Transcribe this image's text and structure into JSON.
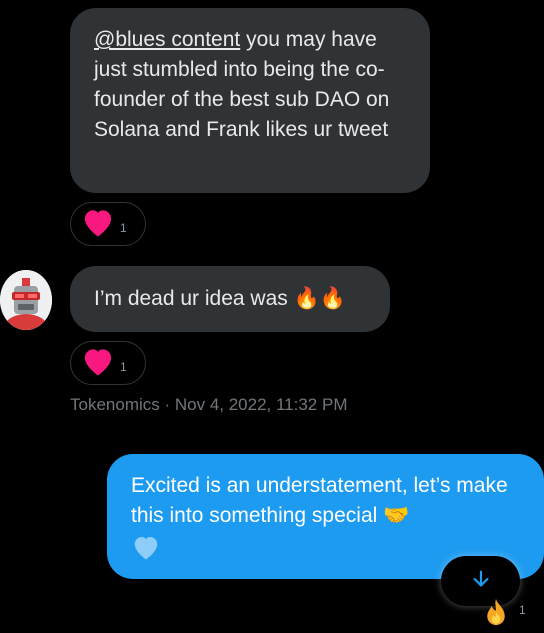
{
  "messages": [
    {
      "mention": "@blues content",
      "text": " you may have just stumbled into being the co-founder of the best sub DAO on Solana and Frank likes ur tweet",
      "reaction": {
        "icon": "heart-icon",
        "count": "1"
      }
    },
    {
      "text": "I’m dead ur idea was ",
      "emoji": "🔥🔥",
      "reaction": {
        "icon": "heart-icon",
        "count": "1"
      }
    },
    {
      "text": "Excited is an understatement, let’s make this into something special ",
      "emoji": "🤝",
      "reaction": {
        "icon": "fire-icon",
        "count": "1"
      }
    }
  ],
  "meta": {
    "text": "Tokenomics · Nov 4, 2022, 11:32 PM"
  },
  "colors": {
    "incoming": "#2f3336",
    "outgoing": "#1d9bf0",
    "heart": "#f91880",
    "meta": "#71767b"
  }
}
